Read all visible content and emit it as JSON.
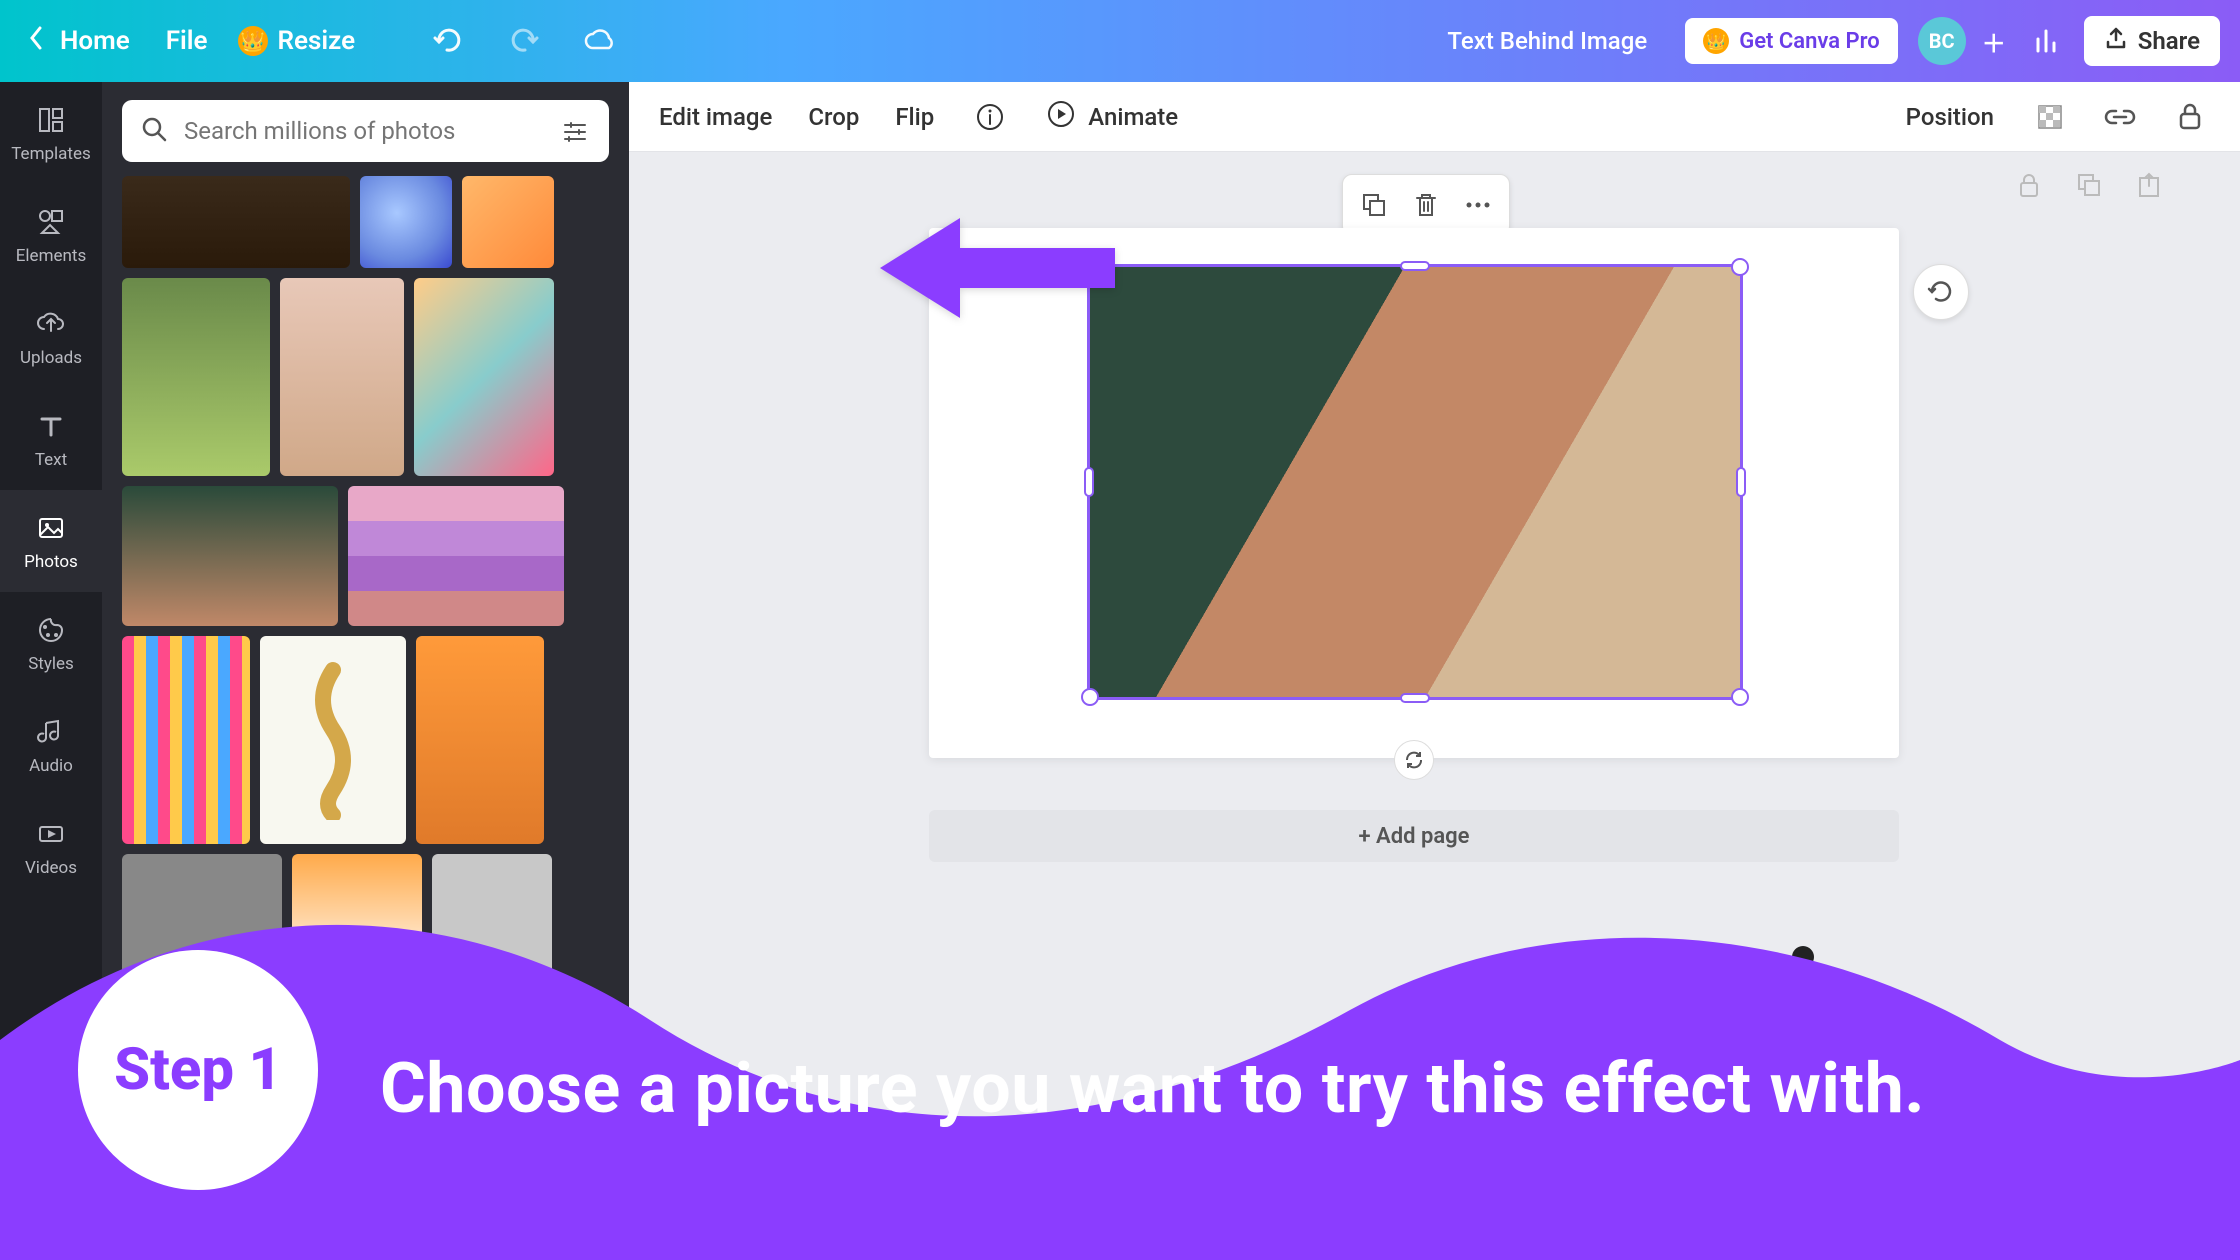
{
  "topbar": {
    "home": "Home",
    "file": "File",
    "resize": "Resize",
    "doc_title": "Text Behind Image",
    "get_pro": "Get Canva Pro",
    "avatar_initials": "BC",
    "share": "Share"
  },
  "rail": {
    "templates": "Templates",
    "elements": "Elements",
    "uploads": "Uploads",
    "text": "Text",
    "photos": "Photos",
    "styles": "Styles",
    "audio": "Audio",
    "videos": "Videos"
  },
  "search": {
    "placeholder": "Search millions of photos"
  },
  "ctx": {
    "edit_image": "Edit image",
    "crop": "Crop",
    "flip": "Flip",
    "animate": "Animate",
    "position": "Position"
  },
  "canvas": {
    "add_page": "+ Add page"
  },
  "tutorial": {
    "step_label": "Step 1",
    "step_text": "Choose a picture you want to try this effect with."
  },
  "colors": {
    "accent_purple": "#8b3dff",
    "selection": "#8b5cf6"
  }
}
